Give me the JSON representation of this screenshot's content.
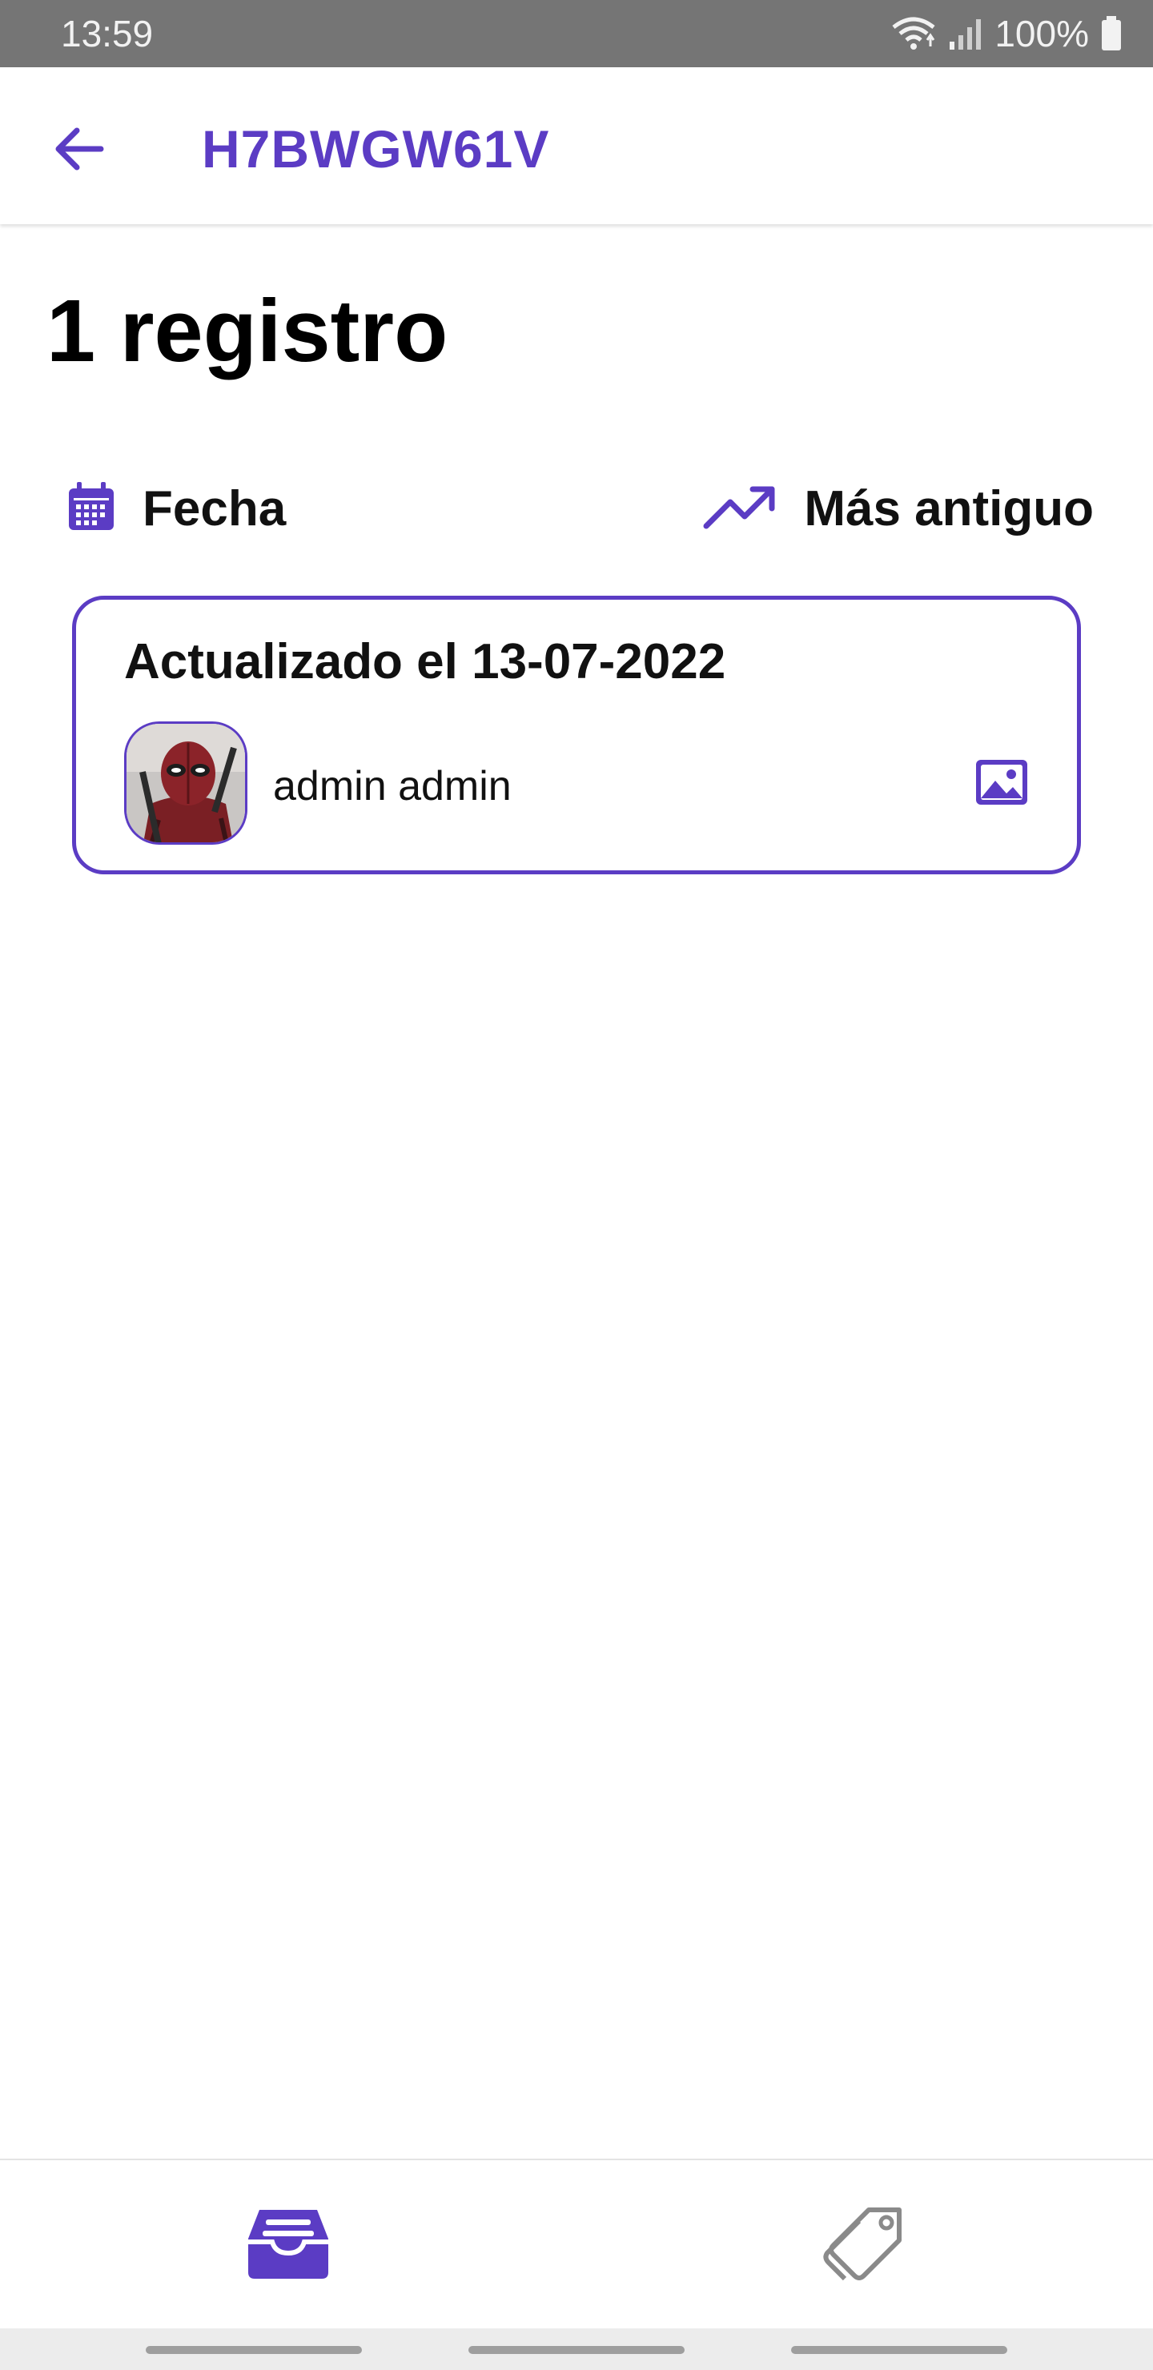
{
  "colors": {
    "accent": "#5b3cc4",
    "status_bar": "#757575",
    "inactive_icon": "#8a8a8a"
  },
  "status_bar": {
    "time": "13:59",
    "battery": "100%",
    "icons": [
      "wifi-icon",
      "signal-icon",
      "battery-icon"
    ]
  },
  "app_bar": {
    "title": "H7BWGW61V",
    "back_icon": "arrow-left-icon"
  },
  "summary": {
    "count_label": "1 registro"
  },
  "sort": {
    "field_icon": "calendar-icon",
    "field_label": "Fecha",
    "order_icon": "trending-up-icon",
    "order_label": "Más antiguo"
  },
  "records": [
    {
      "title": "Actualizado el 13-07-2022",
      "author": "admin admin",
      "avatar": "deadpool-avatar",
      "attachment_icon": "image-icon"
    }
  ],
  "bottom_nav": {
    "items": [
      {
        "icon": "inbox-tray-icon",
        "active": true
      },
      {
        "icon": "tag-icon",
        "active": false
      }
    ]
  }
}
